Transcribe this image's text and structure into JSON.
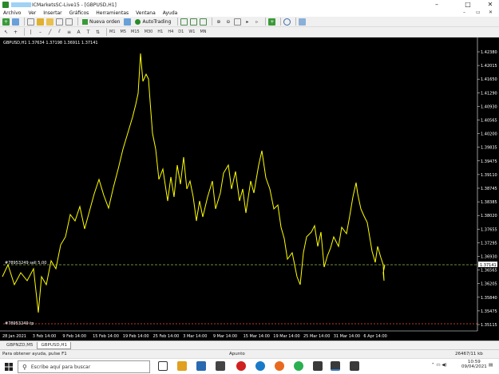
{
  "window": {
    "title": "ICMarketsSC-Live15 - [GBPUSD,H1]",
    "minimize": "–",
    "maximize": "□",
    "close": "✕"
  },
  "menu": [
    "Archivo",
    "Ver",
    "Insertar",
    "Gráficos",
    "Herramientas",
    "Ventana",
    "Ayuda"
  ],
  "toolbar": {
    "new_order": "Nueva orden",
    "autotrading": "AutoTrading",
    "timeframes": [
      "M1",
      "M5",
      "M15",
      "M30",
      "H1",
      "H4",
      "D1",
      "W1",
      "MN"
    ],
    "active_timeframe": "H1"
  },
  "chart": {
    "header": "GBPUSD,H1  1.37634 1.37198 1.36911 1.37141",
    "current_price": "1.37141",
    "order_line_label": "#78953249 sell 5.00",
    "tp_line_label": "#78953249 tp",
    "price_labels": [
      "1.42380",
      "1.42015",
      "1.41650",
      "1.41290",
      "1.40930",
      "1.40565",
      "1.40200",
      "1.39835",
      "1.39475",
      "1.39110",
      "1.38745",
      "1.38385",
      "1.38020",
      "1.37655",
      "1.37295",
      "1.36930",
      "1.36565",
      "1.36205",
      "1.35840",
      "1.35475",
      "1.35115"
    ],
    "time_labels": [
      "28 Jan 2021",
      "3 Feb 14:00",
      "9 Feb 14:00",
      "15 Feb 14:00",
      "19 Feb 14:00",
      "25 Feb 14:00",
      "3 Mar 14:00",
      "9 Mar 14:00",
      "15 Mar 14:00",
      "19 Mar 14:00",
      "25 Mar 14:00",
      "31 Mar 14:00",
      "6 Apr 14:00"
    ],
    "colors": {
      "background": "#000000",
      "line": "#ffff00",
      "grid": "#ffffff",
      "current_price_line": "#6b8e3a",
      "tp_line": "#c0392b",
      "current_price_bg": "#ffffff"
    }
  },
  "tabs": [
    "GBPNZD,M5",
    "GBPUSD,H1"
  ],
  "active_tab": "GBPUSD,H1",
  "status": {
    "help": "Para obtener ayuda, pulse F1",
    "profile": "Apunto",
    "traffic": "26467/11 kb"
  },
  "taskbar": {
    "search_placeholder": "Escribe aquí para buscar",
    "time": "10:59",
    "date": "09/04/2021"
  }
}
